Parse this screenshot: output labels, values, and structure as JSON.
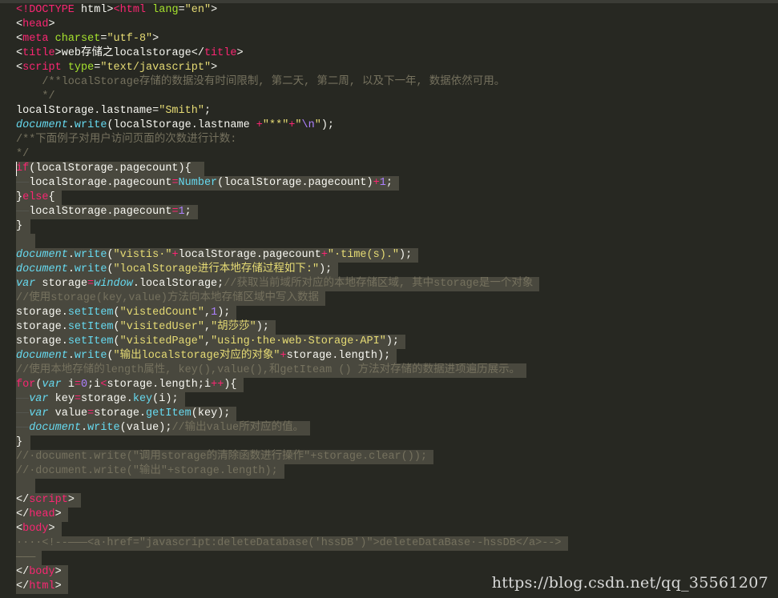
{
  "editor": {
    "lines": [
      [
        [
          "t-tag",
          "<!DOCTYPE"
        ],
        [
          "t-pl",
          " html>"
        ],
        [
          "t-tag",
          "<html"
        ],
        [
          "t-pl",
          " "
        ],
        [
          "t-attr",
          "lang"
        ],
        [
          "t-pl",
          "="
        ],
        [
          "t-str",
          "\"en\""
        ],
        [
          "t-pl",
          ">"
        ]
      ],
      [
        [
          "t-pl",
          "<"
        ],
        [
          "t-tag",
          "head"
        ],
        [
          "t-pl",
          ">"
        ]
      ],
      [
        [
          "t-pl",
          "<"
        ],
        [
          "t-tag",
          "meta"
        ],
        [
          "t-pl",
          " "
        ],
        [
          "t-attr",
          "charset"
        ],
        [
          "t-pl",
          "="
        ],
        [
          "t-str",
          "\"utf-8\""
        ],
        [
          "t-pl",
          ">"
        ]
      ],
      [
        [
          "t-pl",
          "<"
        ],
        [
          "t-tag",
          "title"
        ],
        [
          "t-pl",
          ">web存储之localstorage</"
        ],
        [
          "t-tag",
          "title"
        ],
        [
          "t-pl",
          ">"
        ]
      ],
      [
        [
          "t-pl",
          "<"
        ],
        [
          "t-tag",
          "script"
        ],
        [
          "t-pl",
          " "
        ],
        [
          "t-attr",
          "type"
        ],
        [
          "t-pl",
          "="
        ],
        [
          "t-str",
          "\"text/javascript\""
        ],
        [
          "t-pl",
          ">"
        ]
      ],
      [
        [
          "t-cm",
          "    /**localStorage存储的数据没有时间限制, 第二天, 第二周, 以及下一年, 数据依然可用。"
        ]
      ],
      [
        [
          "t-cm",
          "    */"
        ]
      ],
      [
        [
          "t-pl",
          "localStorage.lastname="
        ],
        [
          "t-str",
          "\"Smith\""
        ],
        [
          "t-pl",
          ";"
        ]
      ],
      [
        [
          "t-fn",
          "document"
        ],
        [
          "t-pl",
          "."
        ],
        [
          "t-call",
          "write"
        ],
        [
          "t-pl",
          "(localStorage.lastname "
        ],
        [
          "t-op",
          "+"
        ],
        [
          "t-str",
          "\"**\""
        ],
        [
          "t-op",
          "+"
        ],
        [
          "t-str",
          "\""
        ],
        [
          "t-num",
          "\\n"
        ],
        [
          "t-str",
          "\""
        ],
        [
          "t-pl",
          ");"
        ]
      ],
      [
        [
          "t-cm",
          "/**下面例子对用户访问页面的次数进行计数:"
        ]
      ],
      [
        [
          "t-cm",
          "*/"
        ]
      ],
      [
        [
          "t-kw",
          "if"
        ],
        [
          "t-pl",
          "(localStorage.pagecount){ "
        ]
      ],
      [
        [
          "t-ind",
          "——"
        ],
        [
          "t-pl",
          "localStorage.pagecount"
        ],
        [
          "t-op",
          "="
        ],
        [
          "t-call",
          "Number"
        ],
        [
          "t-pl",
          "(localStorage.pagecount)"
        ],
        [
          "t-op",
          "+"
        ],
        [
          "t-num",
          "1"
        ],
        [
          "t-pl",
          ";"
        ]
      ],
      [
        [
          "t-pl",
          "}"
        ],
        [
          "t-kw",
          "else"
        ],
        [
          "t-pl",
          "{"
        ]
      ],
      [
        [
          "t-ind",
          "——"
        ],
        [
          "t-pl",
          "localStorage.pagecount"
        ],
        [
          "t-op",
          "="
        ],
        [
          "t-num",
          "1"
        ],
        [
          "t-pl",
          ";"
        ]
      ],
      [
        [
          "t-pl",
          "}"
        ]
      ],
      [
        [
          "t-pl",
          "  "
        ]
      ],
      [
        [
          "t-fn",
          "document"
        ],
        [
          "t-pl",
          "."
        ],
        [
          "t-call",
          "write"
        ],
        [
          "t-pl",
          "("
        ],
        [
          "t-str",
          "\"vistis·\""
        ],
        [
          "t-op",
          "+"
        ],
        [
          "t-pl",
          "localStorage.pagecount"
        ],
        [
          "t-op",
          "+"
        ],
        [
          "t-str",
          "\"·time(s).\""
        ],
        [
          "t-pl",
          ");"
        ]
      ],
      [
        [
          "t-fn",
          "document"
        ],
        [
          "t-pl",
          "."
        ],
        [
          "t-call",
          "write"
        ],
        [
          "t-pl",
          "("
        ],
        [
          "t-str",
          "\"localStorage进行本地存储过程如下:\""
        ],
        [
          "t-pl",
          ");"
        ]
      ],
      [
        [
          "t-fn",
          "var"
        ],
        [
          "t-pl",
          " storage"
        ],
        [
          "t-op",
          "="
        ],
        [
          "t-fn",
          "window"
        ],
        [
          "t-pl",
          ".localStorage;"
        ],
        [
          "t-cm",
          "//获取当前域所对应的本地存储区域, 其中storage是一个对象"
        ]
      ],
      [
        [
          "t-cm",
          "//使用storage(key,value)方法向本地存储区域中写入数据"
        ]
      ],
      [
        [
          "t-pl",
          "storage."
        ],
        [
          "t-call",
          "setItem"
        ],
        [
          "t-pl",
          "("
        ],
        [
          "t-str",
          "\"vistedCount\""
        ],
        [
          "t-pl",
          ","
        ],
        [
          "t-num",
          "1"
        ],
        [
          "t-pl",
          ");"
        ]
      ],
      [
        [
          "t-pl",
          "storage."
        ],
        [
          "t-call",
          "setItem"
        ],
        [
          "t-pl",
          "("
        ],
        [
          "t-str",
          "\"visitedUser\""
        ],
        [
          "t-pl",
          ","
        ],
        [
          "t-str",
          "\"胡莎莎\""
        ],
        [
          "t-pl",
          ");"
        ]
      ],
      [
        [
          "t-pl",
          "storage."
        ],
        [
          "t-call",
          "setItem"
        ],
        [
          "t-pl",
          "("
        ],
        [
          "t-str",
          "\"visitedPage\""
        ],
        [
          "t-pl",
          ","
        ],
        [
          "t-str",
          "\"using·the·web·Storage·API\""
        ],
        [
          "t-pl",
          ");"
        ]
      ],
      [
        [
          "t-fn",
          "document"
        ],
        [
          "t-pl",
          "."
        ],
        [
          "t-call",
          "write"
        ],
        [
          "t-pl",
          "("
        ],
        [
          "t-str",
          "\"输出localstorage对应的对象\""
        ],
        [
          "t-op",
          "+"
        ],
        [
          "t-pl",
          "storage.length);"
        ]
      ],
      [
        [
          "t-cm",
          "//使用本地存储的length属性, key(),value(),和getIteam () 方法对存储的数据进项遍历展示。"
        ]
      ],
      [
        [
          "t-kw",
          "for"
        ],
        [
          "t-pl",
          "("
        ],
        [
          "t-fn",
          "var"
        ],
        [
          "t-pl",
          " i"
        ],
        [
          "t-op",
          "="
        ],
        [
          "t-num",
          "0"
        ],
        [
          "t-pl",
          ";i"
        ],
        [
          "t-op",
          "<"
        ],
        [
          "t-pl",
          "storage.length;i"
        ],
        [
          "t-op",
          "++"
        ],
        [
          "t-pl",
          "){"
        ]
      ],
      [
        [
          "t-ind",
          "——"
        ],
        [
          "t-fn",
          "var"
        ],
        [
          "t-pl",
          " key"
        ],
        [
          "t-op",
          "="
        ],
        [
          "t-pl",
          "storage."
        ],
        [
          "t-call",
          "key"
        ],
        [
          "t-pl",
          "(i);"
        ]
      ],
      [
        [
          "t-ind",
          "——"
        ],
        [
          "t-fn",
          "var"
        ],
        [
          "t-pl",
          " value"
        ],
        [
          "t-op",
          "="
        ],
        [
          "t-pl",
          "storage."
        ],
        [
          "t-call",
          "getItem"
        ],
        [
          "t-pl",
          "(key);"
        ]
      ],
      [
        [
          "t-ind",
          "——"
        ],
        [
          "t-fn",
          "document"
        ],
        [
          "t-pl",
          "."
        ],
        [
          "t-call",
          "write"
        ],
        [
          "t-pl",
          "(value);"
        ],
        [
          "t-cm",
          "//输出value所对应的值。"
        ]
      ],
      [
        [
          "t-pl",
          "}"
        ]
      ],
      [
        [
          "t-cm",
          "//·document.write(\"调用storage的清除函数进行操作\"+storage.clear());"
        ]
      ],
      [
        [
          "t-cm",
          "//·document.write(\"输出\"+storage.length);"
        ]
      ],
      [
        [
          "t-pl",
          "  "
        ]
      ],
      [
        [
          "t-pl",
          "</"
        ],
        [
          "t-tag",
          "script"
        ],
        [
          "t-pl",
          ">"
        ]
      ],
      [
        [
          "t-pl",
          "</"
        ],
        [
          "t-tag",
          "head"
        ],
        [
          "t-pl",
          ">"
        ]
      ],
      [
        [
          "t-pl",
          "<"
        ],
        [
          "t-tag",
          "body"
        ],
        [
          "t-pl",
          ">"
        ]
      ],
      [
        [
          "t-cm",
          "····<!--———<a·href=\"javascript:deleteDatabase('hssDB')\">deleteDataBase·-hssDB</a>-->"
        ]
      ],
      [
        [
          "t-cm",
          "———"
        ]
      ],
      [
        [
          "t-pl",
          "</"
        ],
        [
          "t-tag",
          "body"
        ],
        [
          "t-pl",
          ">"
        ]
      ],
      [
        [
          "t-pl",
          "</"
        ],
        [
          "t-tag",
          "html"
        ],
        [
          "t-pl",
          ">"
        ]
      ]
    ],
    "selected_from_line": 11
  },
  "watermark": "https://blog.csdn.net/qq_35561207"
}
